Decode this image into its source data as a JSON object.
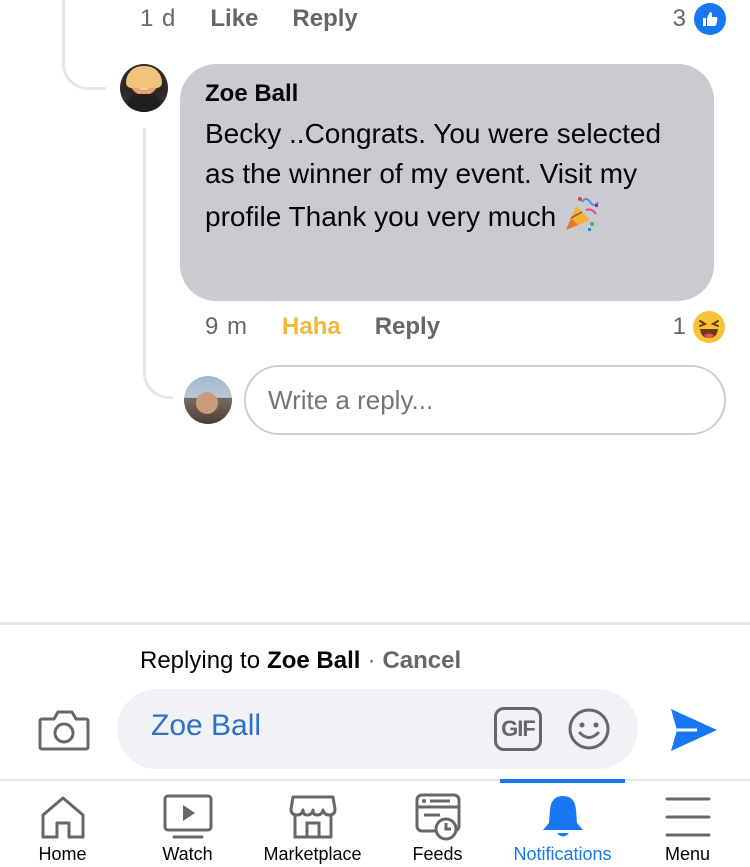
{
  "previous_comment": {
    "time": "1 d",
    "like_label": "Like",
    "reply_label": "Reply",
    "reaction_count": "3",
    "reaction_icon": "like-icon"
  },
  "comment": {
    "author": "Zoe Ball",
    "text": "Becky  ..Congrats. You were selected as the winner of my event. Visit my profile Thank you very much",
    "emoji": "party-popper",
    "time": "9 m",
    "reaction_label": "Haha",
    "reply_label": "Reply",
    "reaction_count": "1",
    "reaction_icon": "haha-icon"
  },
  "reply_box": {
    "placeholder": "Write a reply..."
  },
  "composer": {
    "replying_prefix": "Replying to",
    "replying_name": "Zoe Ball",
    "separator": "·",
    "cancel_label": "Cancel",
    "input_value": "Zoe Ball",
    "gif_label": "GIF"
  },
  "nav": {
    "items": [
      {
        "label": "Home",
        "icon": "home-icon"
      },
      {
        "label": "Watch",
        "icon": "watch-icon"
      },
      {
        "label": "Marketplace",
        "icon": "marketplace-icon"
      },
      {
        "label": "Feeds",
        "icon": "feeds-icon"
      },
      {
        "label": "Notifications",
        "icon": "bell-icon",
        "active": true
      },
      {
        "label": "Menu",
        "icon": "menu-icon"
      }
    ]
  },
  "colors": {
    "accent": "#1877f2",
    "bubble": "#c9cbd0",
    "haha": "#f0b73a",
    "muted": "#65676b"
  }
}
